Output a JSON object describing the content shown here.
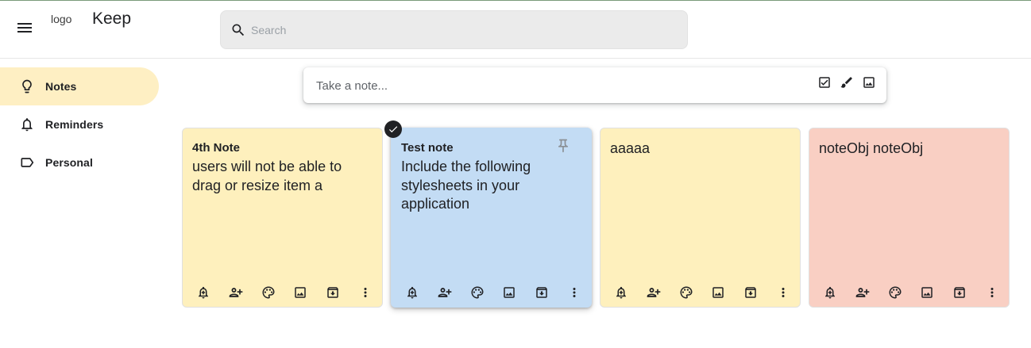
{
  "header": {
    "logo_alt": "logo",
    "app_title": "Keep",
    "search": {
      "placeholder": "Search"
    }
  },
  "sidebar": {
    "items": [
      {
        "label": "Notes",
        "icon": "lightbulb-icon",
        "active": true
      },
      {
        "label": "Reminders",
        "icon": "bell-icon",
        "active": false
      },
      {
        "label": "Personal",
        "icon": "label-icon",
        "active": false
      }
    ]
  },
  "composer": {
    "placeholder": "Take a note..."
  },
  "notes": [
    {
      "title": "4th Note",
      "body": "users will not be able to drag or resize item a",
      "color": "#fef0bd",
      "selected": false,
      "pinned": false
    },
    {
      "title": "Test note",
      "body": "Include the following stylesheets in your application",
      "color": "#c3dcf4",
      "selected": true,
      "pinned": true
    },
    {
      "title": "",
      "body": "aaaaa",
      "color": "#fef0bd",
      "selected": false,
      "pinned": false
    },
    {
      "title": "",
      "body": "noteObj noteObj",
      "color": "#f9cfc3",
      "selected": false,
      "pinned": false
    }
  ],
  "note_toolbar_icons": [
    "add-reminder-icon",
    "collaborator-icon",
    "palette-icon",
    "image-icon",
    "archive-icon",
    "more-vert-icon"
  ],
  "colors": {
    "active_nav": "#feefc3",
    "yellow_note": "#fef0bd",
    "blue_note": "#c3dcf4",
    "red_note": "#f9cfc3"
  }
}
